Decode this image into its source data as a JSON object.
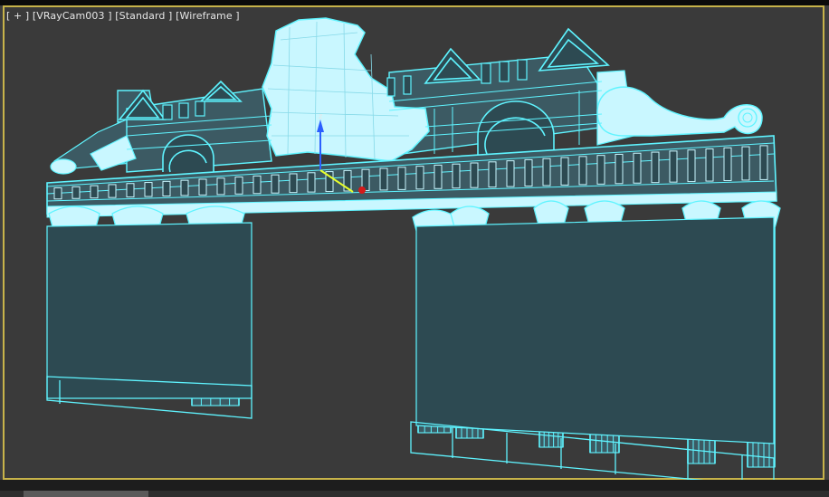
{
  "viewport": {
    "label_parts": [
      "[ + ]",
      "[VRayCam003 ]",
      "[Standard ]",
      "[Wireframe ]"
    ]
  },
  "colors": {
    "wire": "#5ff4ff",
    "wire_light": "#c9f7ff",
    "fill": "#3c5a63",
    "fill_dark": "#2d4a52",
    "bg": "#3a3a3a",
    "border": "#c7b34a"
  },
  "scene": {
    "object": "architectural-arch-gate-wireframe",
    "gizmo_axis_z": "z"
  }
}
